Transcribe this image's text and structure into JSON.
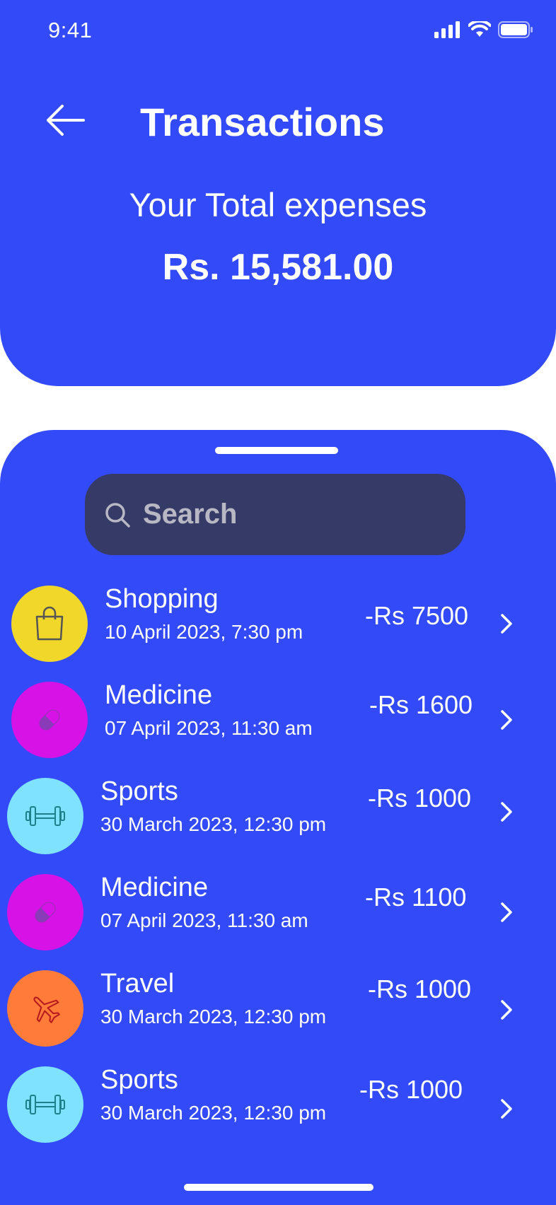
{
  "status": {
    "time": "9:41"
  },
  "header": {
    "title": "Transactions",
    "subtitle": "Your Total expenses",
    "total": "Rs. 15,581.00"
  },
  "search": {
    "placeholder": "Search"
  },
  "transactions": [
    {
      "category": "Shopping",
      "datetime": "10 April 2023, 7:30 pm",
      "amount": "-Rs 7500",
      "icon": "shopping-bag-icon",
      "color": "#f0d72a"
    },
    {
      "category": "Medicine",
      "datetime": "07 April 2023, 11:30 am",
      "amount": "-Rs 1600",
      "icon": "pill-icon",
      "color": "#d612e6"
    },
    {
      "category": "Sports",
      "datetime": "30 March 2023, 12:30 pm",
      "amount": "-Rs 1000",
      "icon": "dumbbell-icon",
      "color": "#7fe3ff"
    },
    {
      "category": "Medicine",
      "datetime": "07 April 2023, 11:30 am",
      "amount": "-Rs 1100",
      "icon": "pill-icon",
      "color": "#d612e6"
    },
    {
      "category": "Travel",
      "datetime": "30 March 2023, 12:30 pm",
      "amount": "-Rs 1000",
      "icon": "airplane-icon",
      "color": "#ff7b3a"
    },
    {
      "category": "Sports",
      "datetime": "30 March 2023, 12:30 pm",
      "amount": "-Rs 1000",
      "icon": "dumbbell-icon",
      "color": "#7fe3ff"
    }
  ],
  "colors": {
    "primary": "#334af8",
    "search_bg": "#363a66"
  }
}
